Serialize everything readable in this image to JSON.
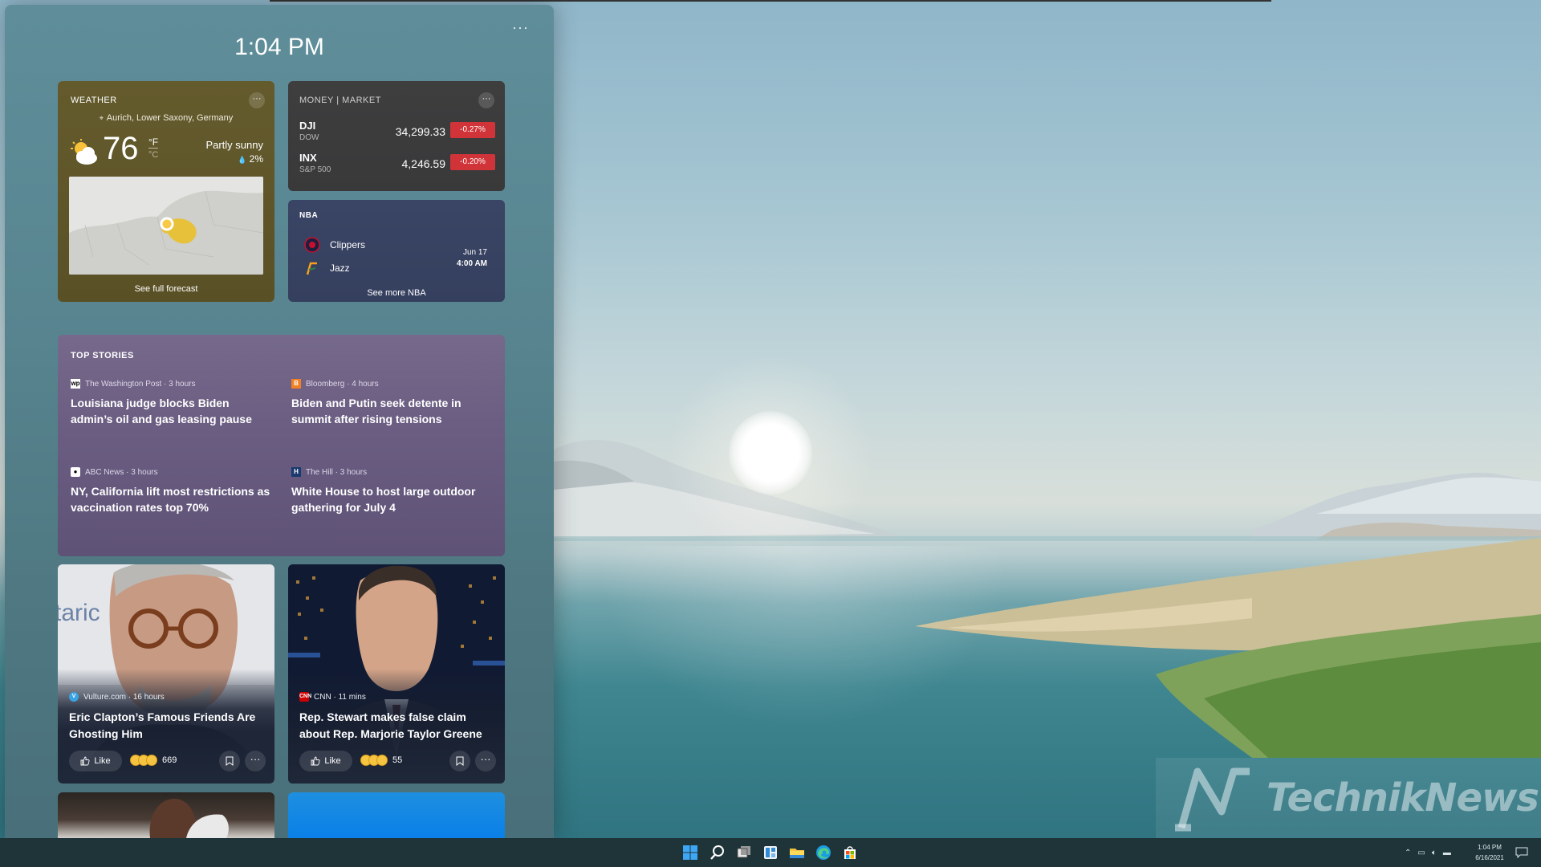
{
  "panel": {
    "time": "1:04 PM",
    "more_label": "···"
  },
  "weather": {
    "title": "WEATHER",
    "location": "Aurich, Lower Saxony, Germany",
    "temperature": "76",
    "unit_f": "°F",
    "unit_c": "°C",
    "condition": "Partly sunny",
    "precipitation": "2%",
    "forecast_link": "See full forecast"
  },
  "money": {
    "title": "MONEY | MARKET",
    "stocks": [
      {
        "symbol": "DJI",
        "name": "DOW",
        "value": "34,299.33",
        "change": "-0.27%"
      },
      {
        "symbol": "INX",
        "name": "S&P 500",
        "value": "4,246.59",
        "change": "-0.20%"
      }
    ],
    "change_color": "#d13438"
  },
  "nba": {
    "title": "NBA",
    "teams": [
      {
        "name": "Clippers",
        "logo": "clippers-logo"
      },
      {
        "name": "Jazz",
        "logo": "jazz-logo"
      }
    ],
    "date": "Jun 17",
    "time": "4:00 AM",
    "more_link": "See more NBA"
  },
  "top_stories": {
    "title": "TOP STORIES",
    "items": [
      {
        "source": "The Washington Post",
        "age": "3 hours",
        "source_line": "The Washington Post · 3 hours",
        "headline": "Louisiana judge blocks Biden admin’s oil and gas leasing pause",
        "icon": "washington-post-icon"
      },
      {
        "source": "Bloomberg",
        "age": "4 hours",
        "source_line": "Bloomberg · 4 hours",
        "headline": "Biden and Putin seek detente in summit after rising tensions",
        "icon": "bloomberg-icon"
      },
      {
        "source": "ABC News",
        "age": "3 hours",
        "source_line": "ABC News · 3 hours",
        "headline": "NY, California lift most restrictions as vaccination rates top 70%",
        "icon": "abc-news-icon"
      },
      {
        "source": "The Hill",
        "age": "3 hours",
        "source_line": "The Hill · 3 hours",
        "headline": "White House to host large outdoor gathering for July 4",
        "icon": "the-hill-icon"
      }
    ]
  },
  "news_cards": [
    {
      "source_line": "Vulture.com · 16 hours",
      "headline": "Eric Clapton’s Famous Friends Are Ghosting Him",
      "like_label": "Like",
      "reaction_count": "669",
      "icon": "vulture-icon"
    },
    {
      "source_line": "CNN · 11 mins",
      "headline": "Rep. Stewart makes false claim about Rep. Marjorie Taylor Greene",
      "like_label": "Like",
      "reaction_count": "55",
      "icon": "cnn-icon"
    }
  ],
  "taskbar": {
    "icons": [
      "start-icon",
      "search-icon",
      "task-view-icon",
      "widgets-icon",
      "file-explorer-icon",
      "edge-icon",
      "store-icon"
    ],
    "clock_time": "1:04 PM",
    "clock_date": "6/16/2021"
  },
  "watermark": {
    "text": "TechnikNews"
  },
  "colors": {
    "weather_card": "#645b2d",
    "money_card": "#3e3e3f",
    "nba_card": "#3a4464",
    "stories_card": "#76698b",
    "taskbar": "#1e3439"
  }
}
